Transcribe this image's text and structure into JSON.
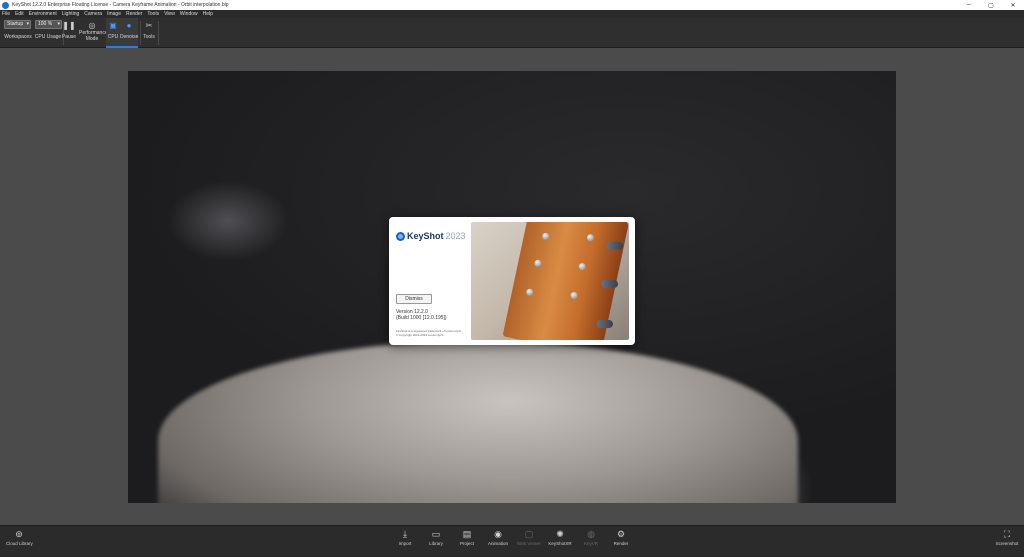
{
  "window": {
    "title": "KeyShot 12.2.0 Enterprise Floating License - Camera Keyframe Animation - Orbit interpolation.bip",
    "controls": {
      "minimize": "─",
      "maximize": "▢",
      "close": "✕"
    }
  },
  "menubar": {
    "items": [
      "File",
      "Edit",
      "Environment",
      "Lighting",
      "Camera",
      "Image",
      "Render",
      "Tools",
      "View",
      "Window",
      "Help"
    ]
  },
  "toolbar": {
    "workspace_value": "Startup",
    "workspace_label": "Workspaces",
    "cpu_usage_value": "100 %",
    "cpu_usage_label": "CPU Usage",
    "pause_label": "Pause",
    "performance_label_1": "Performance",
    "performance_label_2": "Mode",
    "cpu_label": "CPU",
    "denoise_label": "Denoise",
    "tools_label": "Tools"
  },
  "splash": {
    "brand": "KeyShot",
    "year": "2023",
    "button_label": "Dismiss",
    "version_line": "Version 12.2.0",
    "build_line": "(Build 1000 [12.0.195])",
    "legal_line_1": "KeyShot is a registered trademark of Luxion ApS.",
    "legal_line_2": "© Copyright 2001-2023 Luxion ApS."
  },
  "bottombar": {
    "cloud_library": "Cloud Library",
    "import": "Import",
    "library": "Library",
    "project": "Project",
    "animation": "Animation",
    "web_viewer": "Web Viewer",
    "keyshotxr": "KeyShotXR",
    "keyvr": "KeyVR",
    "render": "Render",
    "screenshot": "Screenshot"
  },
  "colors": {
    "accent": "#2d7de0",
    "brand_blue": "#1b5fbf"
  }
}
